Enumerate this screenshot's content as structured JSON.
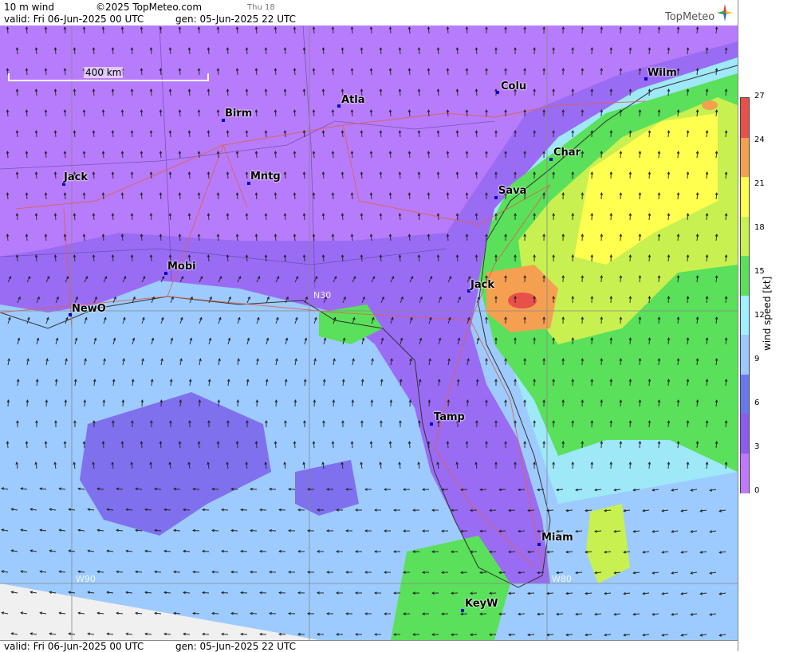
{
  "header": {
    "product": "10 m wind",
    "copyright": "©2025 TopMeteo.com",
    "day_label": "Thu 18",
    "valid": "valid:  Fri  06-Jun-2025  00 UTC",
    "gen": "gen: 05-Jun-2025 22 UTC",
    "logo": "TopMeteo"
  },
  "footer": {
    "valid": "valid:  Fri  06-Jun-2025  00 UTC",
    "gen": "gen: 05-Jun-2025 22 UTC"
  },
  "map": {
    "scale_label": "400 km",
    "grid_labels": {
      "lat": "N30",
      "lon1": "W90",
      "lon2": "W80"
    },
    "cities": [
      {
        "name": "Wilm"
      },
      {
        "name": "Colu"
      },
      {
        "name": "Atla"
      },
      {
        "name": "Birm"
      },
      {
        "name": "Char"
      },
      {
        "name": "Jack"
      },
      {
        "name": "Mntg"
      },
      {
        "name": "Sava"
      },
      {
        "name": "Mobi"
      },
      {
        "name": "Jack"
      },
      {
        "name": "NewO"
      },
      {
        "name": "Tamp"
      },
      {
        "name": "Miam"
      },
      {
        "name": "KeyW"
      }
    ]
  },
  "colorbar": {
    "title": "wind speed [kt]",
    "ticks": [
      "27",
      "24",
      "21",
      "18",
      "15",
      "12",
      "9",
      "6",
      "3",
      "0"
    ],
    "colors": [
      "#e8504a",
      "#f5a050",
      "#ffff50",
      "#c8f050",
      "#5ae05a",
      "#a0f0ff",
      "#9cc8ff",
      "#6a78ee",
      "#8a5cf0",
      "#c078ff"
    ]
  }
}
